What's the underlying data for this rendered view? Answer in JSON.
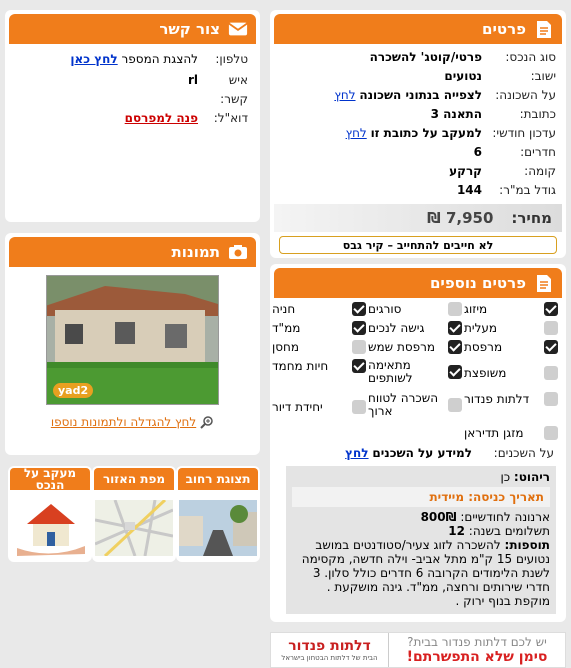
{
  "details": {
    "title": "פרטים",
    "rows": [
      {
        "label": "סוג הנכס:",
        "value": "פרטי/קוטג' להשכרה"
      },
      {
        "label": "ישוב:",
        "value": "נטועים"
      },
      {
        "label": "על השכונה:",
        "value": "לצפייה בנתוני השכונה",
        "link": "לחץ"
      },
      {
        "label": "כתובת:",
        "value": "התאנה 3"
      },
      {
        "label": "עדכון חודשי:",
        "value": "למעקב על כתובת זו",
        "link": "לחץ"
      },
      {
        "label": "חדרים:",
        "value": "6"
      },
      {
        "label": "קומה:",
        "value": "קרקע"
      },
      {
        "label": "גודל במ\"ר:",
        "value": "144"
      }
    ],
    "price_label": "מחיר:",
    "price_value": "7,950 ₪",
    "commitment": "לא חייבים להתחייב – קיר גבס"
  },
  "contact": {
    "title": "צור קשר",
    "phone_label": "טלפון:",
    "phone_text": "להצגת המספר",
    "phone_link": "לחץ כאן",
    "person_label": "איש קשר:",
    "person_value": "rl",
    "email_label": "דוא\"ל:",
    "email_link": "פנה למפרסם"
  },
  "photos": {
    "title": "תמונות",
    "watermark": "yad2",
    "enlarge_link": "לחץ להגדלה ולתמונות נוספו"
  },
  "tiles": [
    {
      "title": "תצוגת רחוב"
    },
    {
      "title": "מפת האזור"
    },
    {
      "title": "מעקב על הנכס"
    }
  ],
  "more": {
    "title": "פרטים נוספים",
    "features": [
      {
        "label": "מיזוג",
        "on": true
      },
      {
        "label": "סורגים",
        "on": false
      },
      {
        "label": "חניה",
        "on": true
      },
      {
        "label": "מעלית",
        "on": false
      },
      {
        "label": "גישה לנכים",
        "on": true
      },
      {
        "label": "ממ\"ד",
        "on": true
      },
      {
        "label": "מרפסת",
        "on": true
      },
      {
        "label": "מרפסת שמש",
        "on": true
      },
      {
        "label": "מחסן",
        "on": false
      },
      {
        "label": "משופצת",
        "on": false
      },
      {
        "label": "מתאימה לשותפים",
        "on": true
      },
      {
        "label": "חיות מחמד",
        "on": true
      },
      {
        "label": "דלתות פנדור",
        "on": false
      },
      {
        "label": "השכרה לטווח ארוך",
        "on": false
      },
      {
        "label": "יחידת דיור",
        "on": false
      },
      {
        "label": "מזגן תדיראן",
        "on": false
      }
    ],
    "neigh_label": "על השכנים:",
    "neigh_value": "למידע על השכנים",
    "neigh_link": "לחץ",
    "furniture_label": "ריהוט:",
    "furniture_value": "כן",
    "entry_label": "תאריך כניסה:",
    "entry_value": "מיידית",
    "arnona_label": "ארנונה לחודשיים:",
    "arnona_value": "800₪",
    "payments_label": "תשלומים בשנה:",
    "payments_value": "12",
    "extra_label": "תוספות:",
    "extra_text": "להשכרה לזוג צעיר/סטודנטים במושב נטועים 15 ק\"מ מתל אביב- וילה חדשה, מקסימה לשנת הלימודים הקרובה 6 חדרים כולל סלון. 3 חדרי שירותים ורחצה, ממ\"ד. גינה מושקעת . מוקפת בנוף ירוק ."
  },
  "banner": {
    "line1": "יש לכם דלתות פנדור בבית?",
    "line2": "סימן שלא התפשרתם!",
    "brand": "דלתות פנדור",
    "brand_sub": "הבית של דלתות הבטחון בישראל"
  }
}
